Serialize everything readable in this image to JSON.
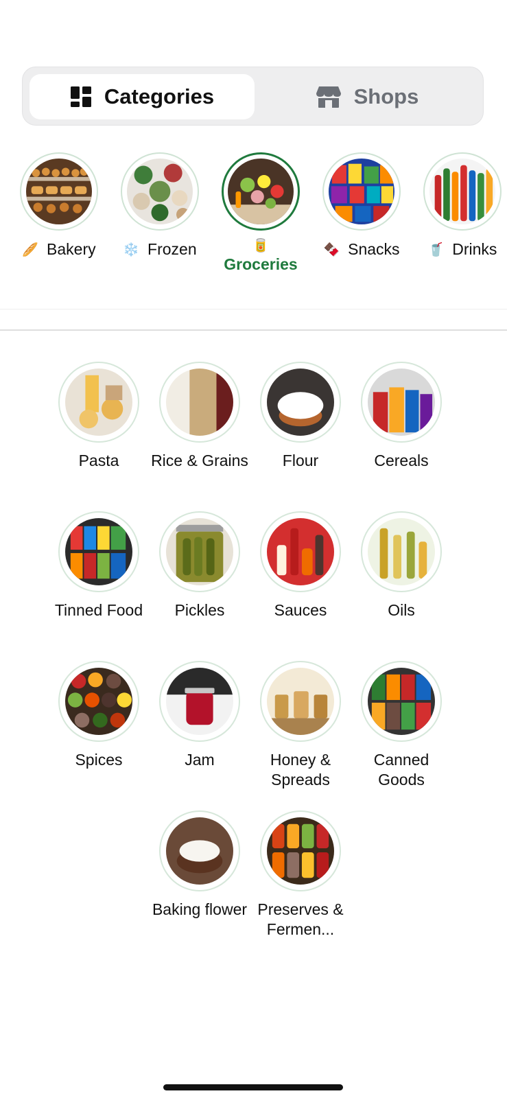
{
  "tabs": {
    "categories_label": "Categories",
    "shops_label": "Shops",
    "active": "Categories"
  },
  "categories": [
    {
      "emoji": "🥖",
      "label": "Bakery",
      "image": "bakery-display-photo"
    },
    {
      "emoji": "❄️",
      "label": "Frozen",
      "image": "frozen-vegetables-photo"
    },
    {
      "emoji": "🥫",
      "label": "Groceries",
      "image": "groceries-produce-photo",
      "selected": true
    },
    {
      "emoji": "🍫",
      "label": "Snacks",
      "image": "snacks-packets-photo"
    },
    {
      "emoji": "🥤",
      "label": "Drinks",
      "image": "soda-bottles-photo"
    }
  ],
  "subcategories": [
    {
      "label": "Pasta",
      "image": "pasta-photo"
    },
    {
      "label": "Rice & Grains",
      "image": "rice-grains-photo"
    },
    {
      "label": "Flour",
      "image": "flour-bowl-photo"
    },
    {
      "label": "Cereals",
      "image": "cereal-boxes-photo"
    },
    {
      "label": "Tinned Food",
      "image": "tinned-food-photo"
    },
    {
      "label": "Pickles",
      "image": "pickle-jars-photo"
    },
    {
      "label": "Sauces",
      "image": "sauce-bottles-photo"
    },
    {
      "label": "Oils",
      "image": "oil-bottles-photo"
    },
    {
      "label": "Spices",
      "image": "spices-photo"
    },
    {
      "label": "Jam",
      "image": "jam-jar-photo"
    },
    {
      "label": "Honey & Spreads",
      "image": "honey-jars-photo"
    },
    {
      "label": "Canned Goods",
      "image": "canned-goods-photo"
    },
    {
      "label": "Baking flower",
      "image": "baking-flour-photo"
    },
    {
      "label": "Preserves & Fermen...",
      "image": "preserves-jars-photo"
    }
  ],
  "colors": {
    "accent": "#1f7a3d",
    "ring": "#d6e7da",
    "toggle_bg": "#eeeeef",
    "inactive_text": "#6b6f76"
  }
}
